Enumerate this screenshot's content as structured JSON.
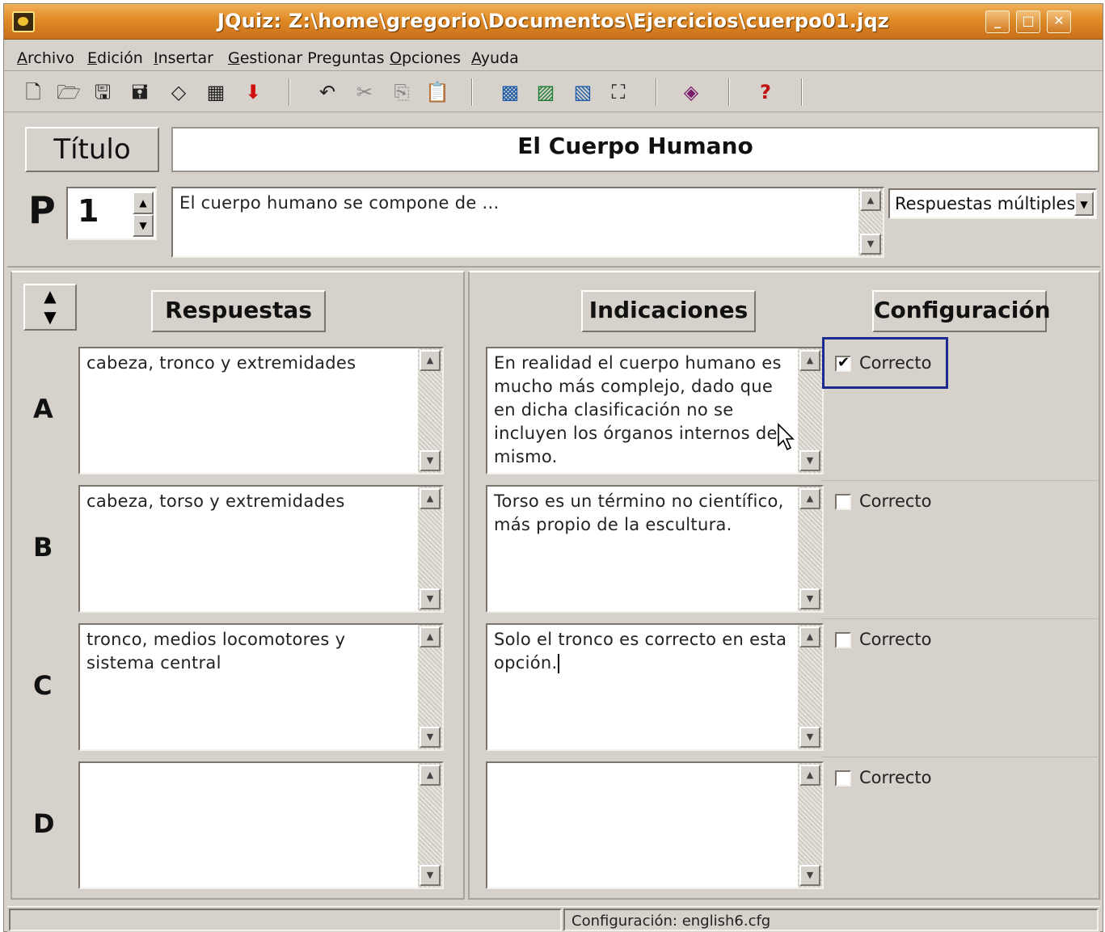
{
  "window": {
    "title": "JQuiz: Z:\\home\\gregorio\\Documentos\\Ejercicios\\cuerpo01.jqz",
    "min_label": "_",
    "max_label": "□",
    "close_label": "✕"
  },
  "menu": [
    "Archivo",
    "Edición",
    "Insertar",
    "Gestionar Preguntas",
    "Opciones",
    "Ayuda"
  ],
  "toolbar": {
    "icons": [
      "new-file-icon",
      "open-folder-icon",
      "save-icon",
      "save-as-icon",
      "eraser-icon",
      "web-page-icon",
      "down-arrow-icon",
      "undo-icon",
      "cut-icon",
      "copy-icon",
      "paste-icon",
      "html-export-icon",
      "image-export-icon",
      "hotpot-icon",
      "add-text-icon",
      "fonts-icon",
      "help-icon"
    ]
  },
  "title_section": {
    "button_label": "Título",
    "value": "El Cuerpo Humano"
  },
  "question": {
    "label": "P",
    "number": "1",
    "text": "El cuerpo humano se compone de ...",
    "type": "Respuestas múltiples"
  },
  "headers": {
    "answers": "Respuestas",
    "hints": "Indicaciones",
    "config": "Configuración"
  },
  "rows": [
    {
      "letter": "A",
      "answer": "cabeza, tronco y extremidades",
      "hint": "En realidad el cuerpo humano es\nmucho más complejo, dado que\nen dicha clasificación no se\nincluyen los órganos internos del\nmismo.",
      "correct_label": "Correcto",
      "correct": true
    },
    {
      "letter": "B",
      "answer": "cabeza, torso y extremidades",
      "hint": "Torso es un término no científico,\nmás propio de la escultura.",
      "correct_label": "Correcto",
      "correct": false
    },
    {
      "letter": "C",
      "answer": "tronco, medios locomotores y\nsistema central",
      "hint": "Solo el tronco es correcto en esta\nopción.",
      "correct_label": "Correcto",
      "correct": false
    },
    {
      "letter": "D",
      "answer": "",
      "hint": "",
      "correct_label": "Correcto",
      "correct": false
    }
  ],
  "status": {
    "config": "Configuración: english6.cfg"
  }
}
